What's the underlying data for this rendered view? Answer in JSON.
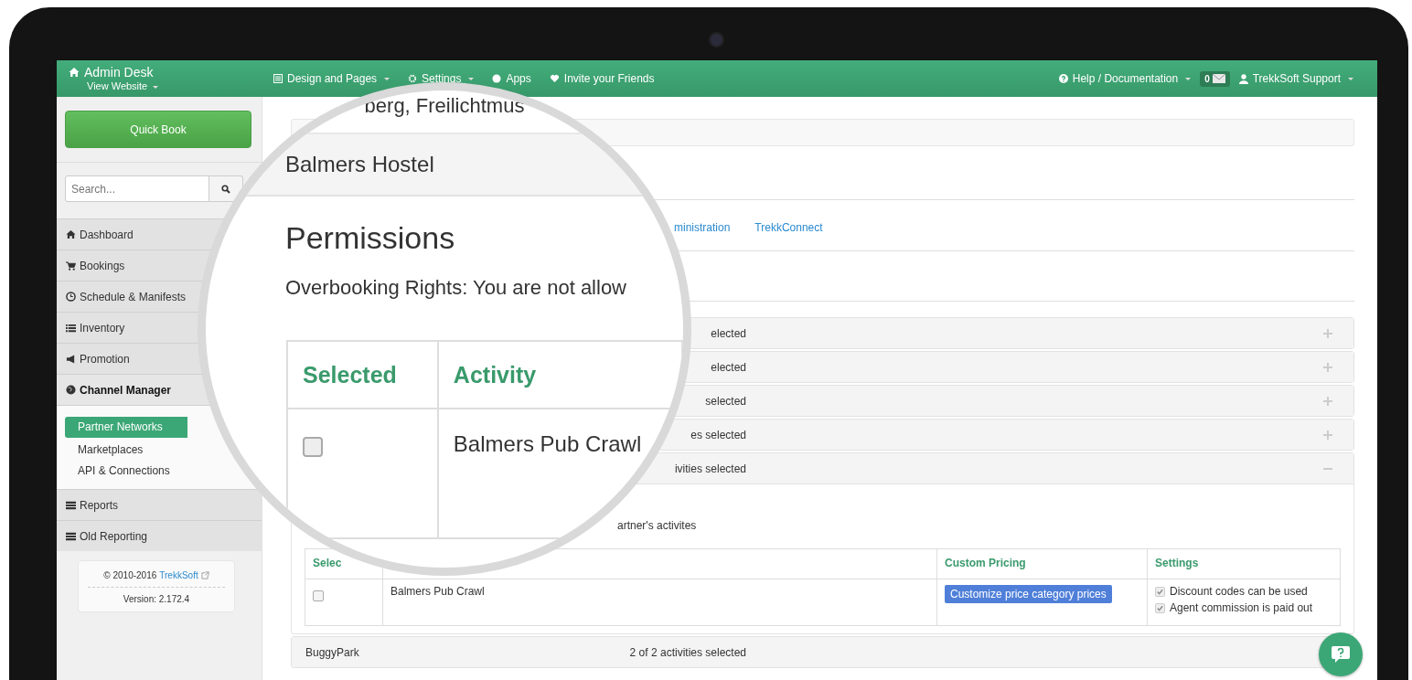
{
  "topbar": {
    "brand": "Admin Desk",
    "view_website": "View Website",
    "nav": [
      {
        "label": "Design and Pages",
        "dropdown": true
      },
      {
        "label": "Settings",
        "dropdown": true
      },
      {
        "label": "Apps",
        "dropdown": false
      },
      {
        "label": "Invite your Friends",
        "dropdown": false
      }
    ],
    "help": "Help / Documentation",
    "messages_count": "0",
    "user": "TrekkSoft Support"
  },
  "sidebar": {
    "quick_book": "Quick Book",
    "search": {
      "placeholder": "Search..."
    },
    "menu": [
      {
        "label": "Dashboard",
        "expanded": false
      },
      {
        "label": "Bookings",
        "expanded": false
      },
      {
        "label": "Schedule & Manifests",
        "expanded": false
      },
      {
        "label": "Inventory",
        "expanded": false
      },
      {
        "label": "Promotion",
        "expanded": false
      },
      {
        "label": "Channel Manager",
        "expanded": true,
        "children": [
          {
            "label": "Partner Networks",
            "selected": true
          },
          {
            "label": "Marketplaces",
            "selected": false
          },
          {
            "label": "API & Connections",
            "selected": false
          }
        ]
      },
      {
        "label": "Reports",
        "expanded": false
      },
      {
        "label": "Old Reporting",
        "expanded": false
      }
    ],
    "footer": {
      "copyright": "© 2010-2016",
      "link": "TrekkSoft",
      "version": "Version: 2.172.4"
    }
  },
  "tabs": [
    {
      "label": "ministration"
    },
    {
      "label": "TrekkConnect"
    }
  ],
  "partners": [
    {
      "count": "elected",
      "expanded": false
    },
    {
      "count": "elected",
      "expanded": false
    },
    {
      "count": "selected",
      "expanded": false
    },
    {
      "count": "es selected",
      "expanded": false
    },
    {
      "count": "ivities selected",
      "expanded": true,
      "note": "artner's activites",
      "table": {
        "columns": {
          "selected": "Selec",
          "custom_pricing": "Custom Pricing",
          "settings": "Settings"
        },
        "rows": [
          {
            "checked": false,
            "activity": "Balmers Pub Crawl",
            "pricing_button": "Customize price category prices",
            "settings": [
              {
                "label": "Discount codes can be used",
                "checked": true
              },
              {
                "label": "Agent commission is paid out",
                "checked": true
              }
            ]
          }
        ]
      }
    },
    {
      "name": "BuggyPark",
      "count": "2 of 2 activities selected"
    }
  ],
  "magnifier": {
    "location": "berg, Freilichtmus",
    "heading": "Balmers Hostel",
    "title": "Permissions",
    "overbooking": "Overbooking Rights: You are not allow",
    "table": {
      "columns": [
        "Selected",
        "Activity"
      ],
      "rows": [
        {
          "checked": false,
          "activity": "Balmers Pub Crawl"
        }
      ]
    }
  }
}
